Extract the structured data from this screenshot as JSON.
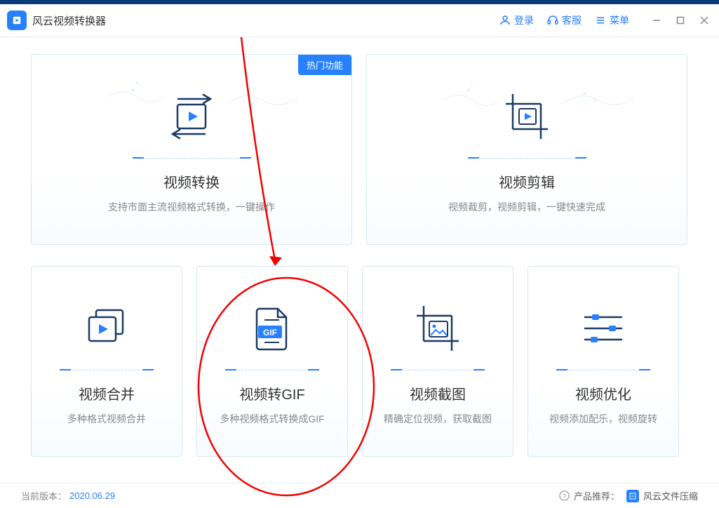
{
  "app": {
    "title": "风云视频转换器"
  },
  "header": {
    "login": "登录",
    "service": "客服",
    "menu": "菜单"
  },
  "cards": {
    "convert": {
      "badge": "热门功能",
      "title": "视频转换",
      "desc": "支持市面主流视频格式转换，一键操作"
    },
    "edit": {
      "title": "视频剪辑",
      "desc": "视频裁剪，视频剪辑，一键快速完成"
    },
    "merge": {
      "title": "视频合并",
      "desc": "多种格式视频合并"
    },
    "gif": {
      "title": "视频转GIF",
      "desc": "多种视频格式转换成GIF"
    },
    "screenshot": {
      "title": "视频截图",
      "desc": "精确定位视频，获取截图"
    },
    "optimize": {
      "title": "视频优化",
      "desc": "视频添加配乐，视频旋转"
    }
  },
  "footer": {
    "version_label": "当前版本：",
    "version": "2020.06.29",
    "recommend_label": "产品推荐：",
    "recommend_app": "风云文件压缩"
  }
}
